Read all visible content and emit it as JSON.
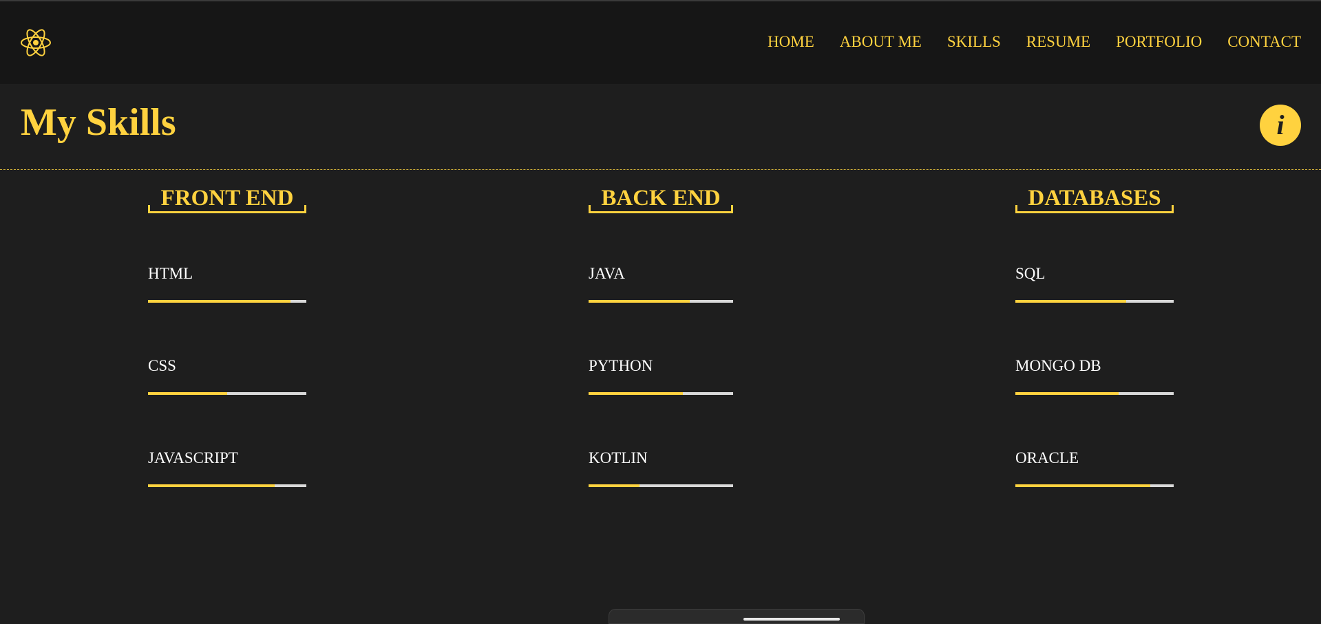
{
  "nav": {
    "logo_icon": "atom-icon",
    "links": [
      "HOME",
      "ABOUT ME",
      "SKILLS",
      "RESUME",
      "PORTFOLIO",
      "CONTACT"
    ]
  },
  "header": {
    "title": "My Skills",
    "info_glyph": "i",
    "info_icon": "info-icon"
  },
  "colors": {
    "accent": "#ffd23f",
    "background": "#1e1e1e",
    "navbar": "#161616",
    "track": "#d9d9d9",
    "text": "#ffffff"
  },
  "columns": [
    {
      "heading": "FRONT END",
      "skills": [
        {
          "name": "HTML",
          "level": 0.9
        },
        {
          "name": "CSS",
          "level": 0.5
        },
        {
          "name": "JAVASCRIPT",
          "level": 0.8
        }
      ]
    },
    {
      "heading": "BACK END",
      "skills": [
        {
          "name": "JAVA",
          "level": 0.7
        },
        {
          "name": "PYTHON",
          "level": 0.65
        },
        {
          "name": "KOTLIN",
          "level": 0.35
        }
      ]
    },
    {
      "heading": "DATABASES",
      "skills": [
        {
          "name": "SQL",
          "level": 0.7
        },
        {
          "name": "MONGO DB",
          "level": 0.65
        },
        {
          "name": "ORACLE",
          "level": 0.85
        }
      ]
    }
  ]
}
